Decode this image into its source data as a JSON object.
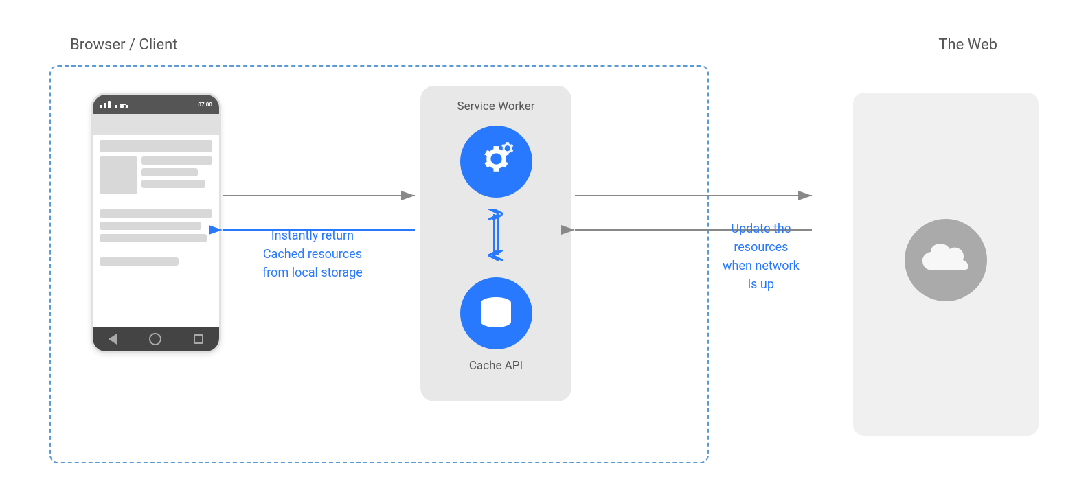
{
  "labels": {
    "browser_client": "Browser / Client",
    "the_web": "The Web",
    "service_worker": "Service Worker",
    "cache_api": "Cache API",
    "instantly_return_line1": "Instantly return",
    "instantly_return_line2": "Cached resources",
    "instantly_return_line3": "from local storage",
    "update_the_line1": "Update the",
    "update_the_line2": "resources",
    "update_the_line3": "when network",
    "update_the_line4": "is up"
  },
  "colors": {
    "blue": "#2979ff",
    "arrow_gray": "#888",
    "dashed_border": "#5b9bd5",
    "panel_bg": "#e8e8e8",
    "web_box_bg": "#f0f0f0",
    "cloud_bg": "#aaa"
  }
}
